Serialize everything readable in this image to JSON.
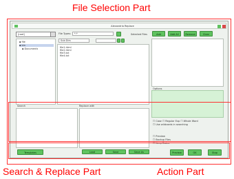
{
  "annotations": {
    "file_selection": "File Selection Part",
    "search_replace": "Search & Replace Part",
    "action": "Action Part"
  },
  "window": {
    "title": "Alexandria Replace"
  },
  "file_part": {
    "drive_select": "[root]",
    "folders": [
      "file",
      "bin",
      "Documents"
    ],
    "file_type_label": "File Types:",
    "file_type_value": "*.*",
    "sub_label": "Sub Dirs",
    "files": [
      "file1.html",
      "file2.html",
      "file3.txt",
      "file4.txt"
    ],
    "top_buttons": [
      "Add",
      "Add All",
      "Remove",
      "Clear"
    ],
    "right_panel_label": "Selected Files",
    "options_label": "Options"
  },
  "search_part": {
    "search_label": "Search",
    "replace_label": "Replace with",
    "checkboxes": [
      "Case",
      "Regular Exp",
      "Whole Word",
      "Use backups"
    ],
    "checkbox_hint": "Use wildcards in searching",
    "extra_options": [
      "Preview",
      "Backup Files",
      "Keep Dates"
    ]
  },
  "action_part": {
    "left_button": "Templates",
    "mid_buttons": [
      "Load",
      "Save",
      "Save As"
    ],
    "right_buttons": [
      "Preview",
      "OK",
      "Stop"
    ]
  }
}
